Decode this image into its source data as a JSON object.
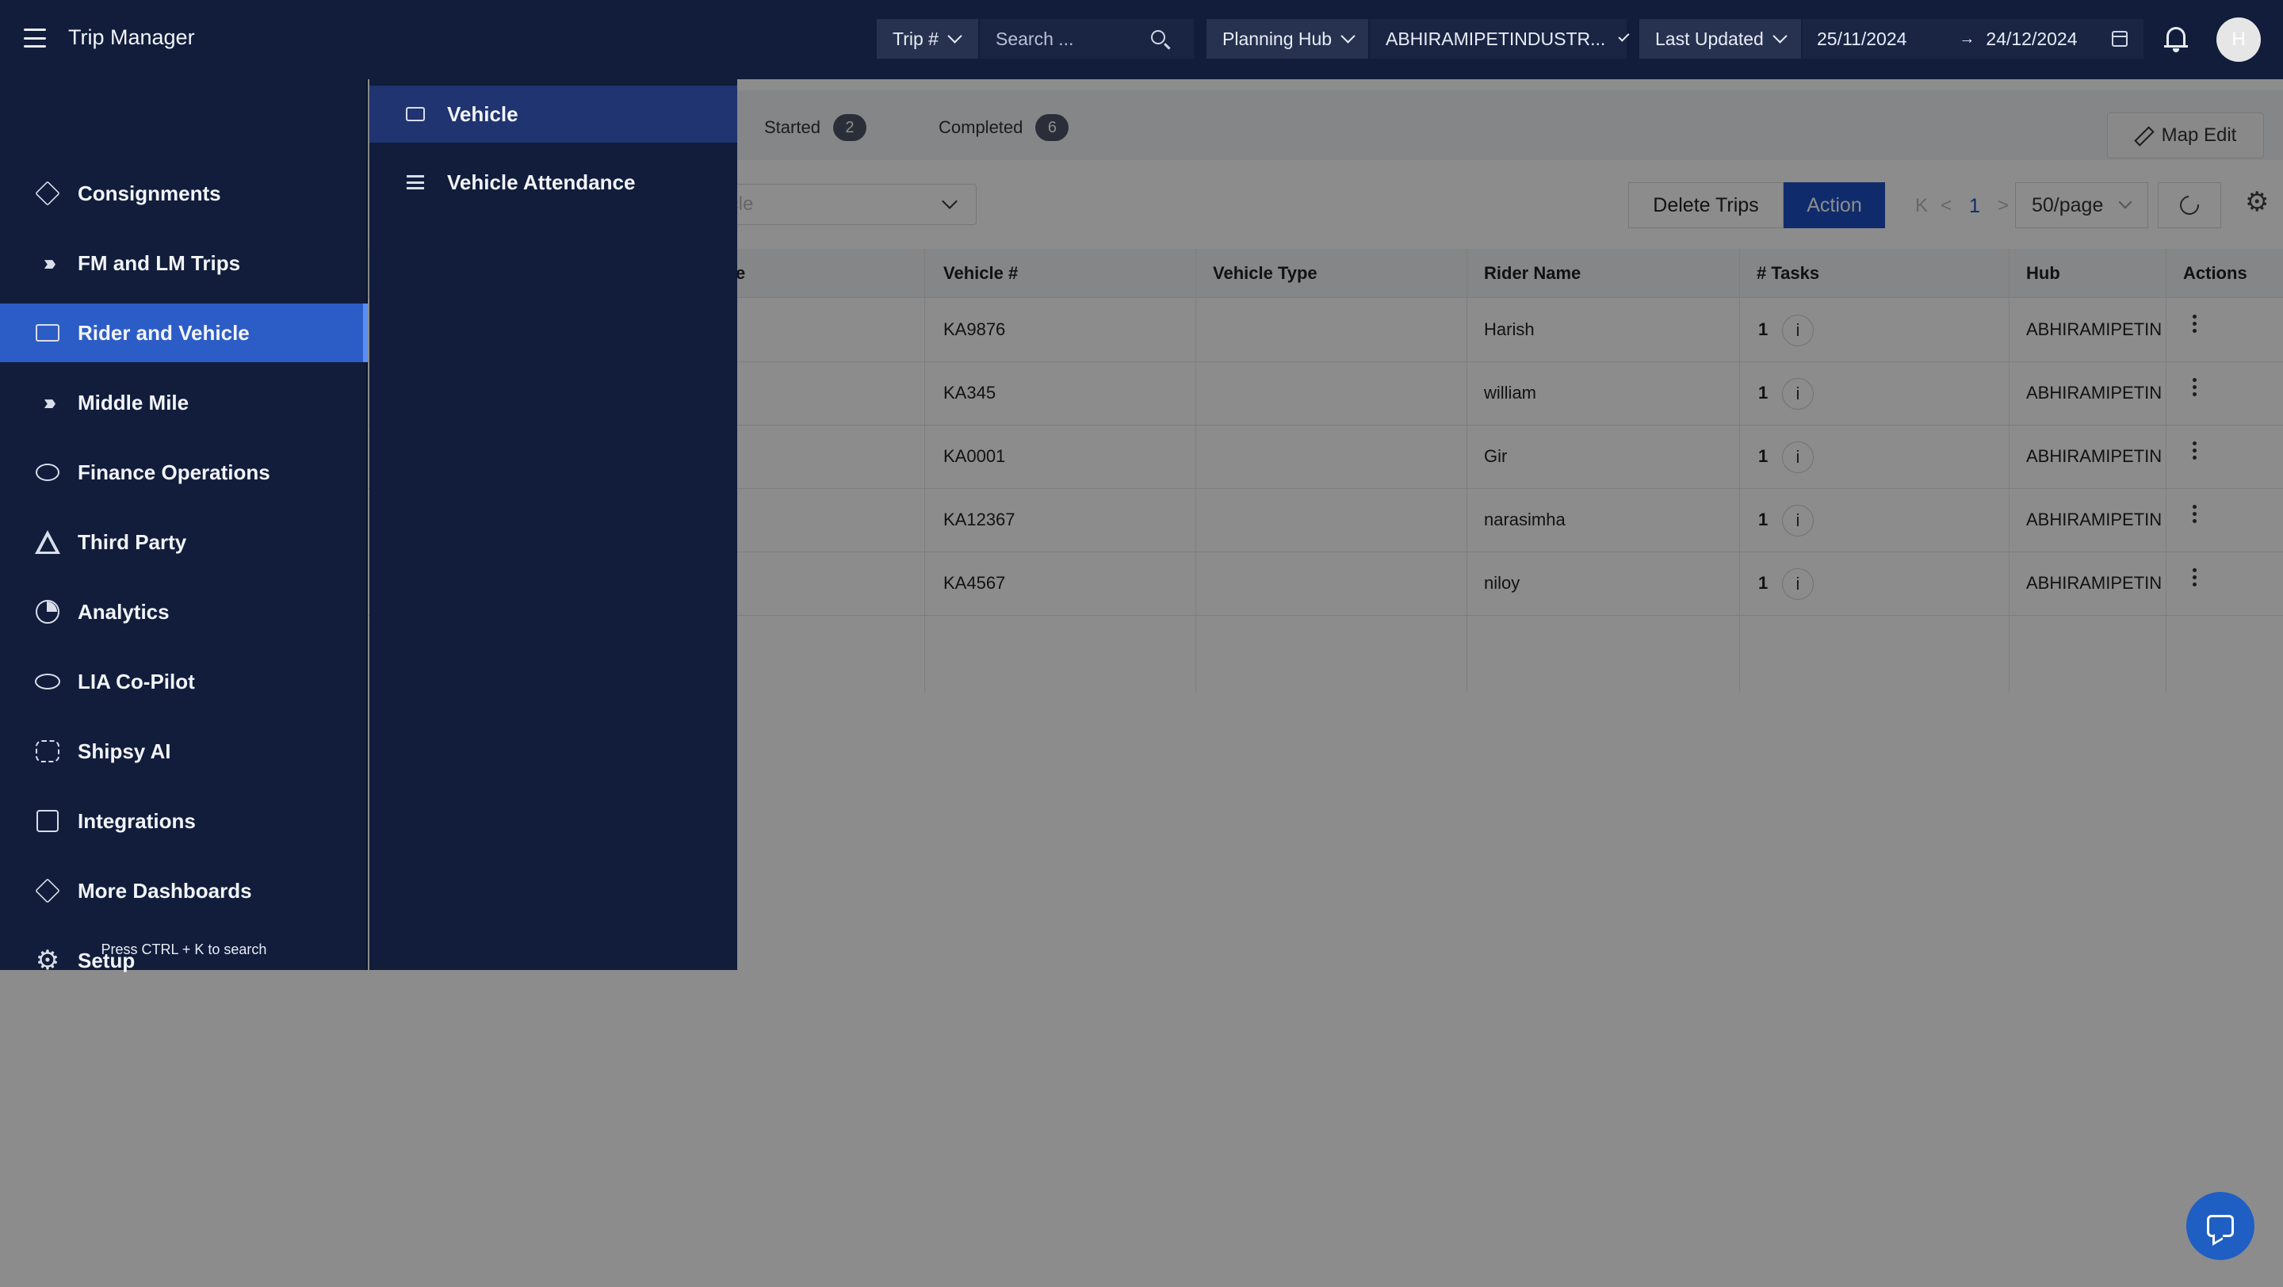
{
  "app": {
    "title": "Trip Manager"
  },
  "topbar": {
    "trip_filter": "Trip #",
    "search_placeholder": "Search ...",
    "planning_hub_label": "Planning Hub",
    "hub_value": "ABHIRAMIPETINDUSTR...",
    "date_type": "Last Updated",
    "date_from": "25/11/2024",
    "date_arrow": "→",
    "date_to": "24/12/2024",
    "avatar_initial": "H"
  },
  "tabs": [
    {
      "label": "Started",
      "count": "2"
    },
    {
      "label": "Completed",
      "count": "6"
    }
  ],
  "toolbar": {
    "map_edit": "Map Edit",
    "vehicle_select_placeholder": "nicle",
    "delete_trips": "Delete Trips",
    "action": "Action",
    "page_first": "K",
    "page_prev": "<",
    "page_current": "1",
    "page_next": ">",
    "per_page": "50/page"
  },
  "table": {
    "columns": {
      "partial": "e",
      "vehicle_no": "Vehicle #",
      "vehicle_type": "Vehicle Type",
      "rider_name": "Rider Name",
      "tasks": "# Tasks",
      "hub": "Hub",
      "actions": "Actions"
    },
    "rows": [
      {
        "vehicle": "KA9876",
        "rider": "Harish",
        "tasks": "1",
        "hub": "ABHIRAMIPETINI"
      },
      {
        "vehicle": "KA345",
        "rider": "william",
        "tasks": "1",
        "hub": "ABHIRAMIPETINI"
      },
      {
        "vehicle": "KA0001",
        "rider": "Gir",
        "tasks": "1",
        "hub": "ABHIRAMIPETINI"
      },
      {
        "vehicle": "KA12367",
        "rider": "narasimha",
        "tasks": "1",
        "hub": "ABHIRAMIPETINI"
      },
      {
        "vehicle": "KA4567",
        "rider": "niloy",
        "tasks": "1",
        "hub": "ABHIRAMIPETINI"
      }
    ],
    "info_glyph": "i"
  },
  "sidebar": {
    "items": [
      {
        "label": "Consignments",
        "icon": "cube-icon"
      },
      {
        "label": "FM and LM Trips",
        "icon": "chevrons-icon"
      },
      {
        "label": "Rider and Vehicle",
        "icon": "truck-icon"
      },
      {
        "label": "Middle Mile",
        "icon": "chevrons-icon"
      },
      {
        "label": "Finance Operations",
        "icon": "coins-icon"
      },
      {
        "label": "Third Party",
        "icon": "triangle-icon"
      },
      {
        "label": "Analytics",
        "icon": "pie-icon"
      },
      {
        "label": "LIA Co-Pilot",
        "icon": "eye-icon"
      },
      {
        "label": "Shipsy AI",
        "icon": "brain-icon"
      },
      {
        "label": "Integrations",
        "icon": "integration-icon"
      },
      {
        "label": "More Dashboards",
        "icon": "cube-icon"
      },
      {
        "label": "Setup",
        "icon": "gear-icon"
      }
    ],
    "active_index": 2,
    "search_hint": "Press CTRL + K to search"
  },
  "submenu": {
    "items": [
      {
        "label": "Vehicle",
        "icon": "truck-icon"
      },
      {
        "label": "Vehicle Attendance",
        "icon": "list-icon"
      }
    ]
  },
  "colors": {
    "nav_bg": "#111d3b",
    "active_nav": "#2c5cc6",
    "primary_button": "#1d4fc4",
    "chat_button": "#1f5fc4"
  }
}
